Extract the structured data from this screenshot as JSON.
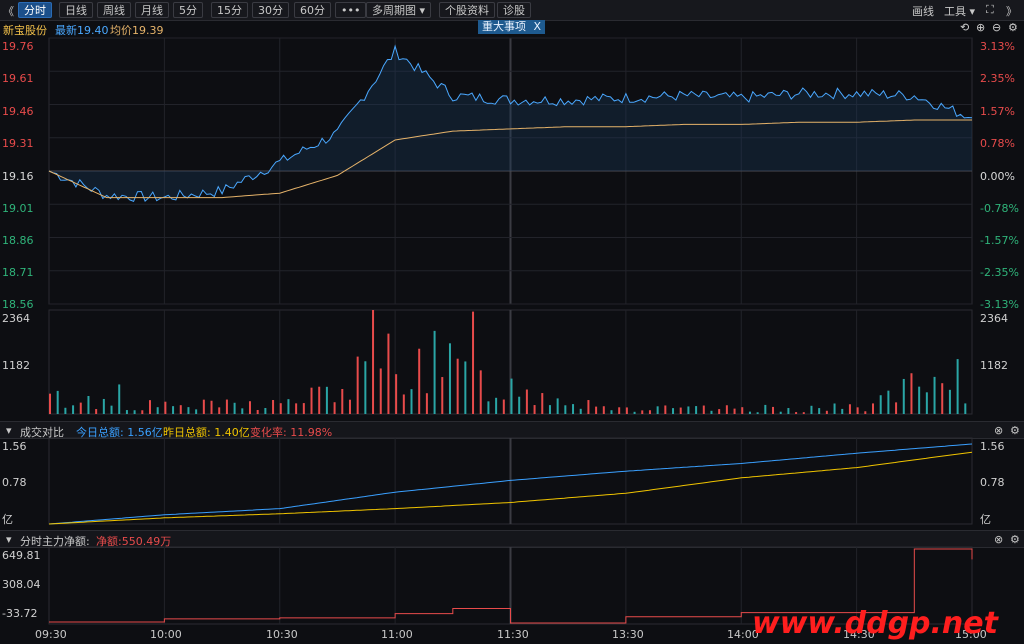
{
  "toolbar": {
    "back_glyph": "《",
    "tabs": [
      {
        "label": "分时",
        "active": true
      },
      {
        "label": "日线"
      },
      {
        "label": "周线"
      },
      {
        "label": "月线"
      },
      {
        "label": "5分"
      },
      {
        "label": "15分"
      },
      {
        "label": "30分"
      },
      {
        "label": "60分"
      },
      {
        "label": "•••"
      },
      {
        "label": "多周期图 ▾"
      },
      {
        "label": "个股资料"
      },
      {
        "label": "诊股"
      }
    ],
    "draw_label": "画线",
    "tools_label": "工具 ▾",
    "expand_glyph": "⛶",
    "forward_glyph": "》"
  },
  "info": {
    "stock_name": "新宝股份",
    "latest": "最新19.40",
    "avg": "均价19.39",
    "event_badge": "重大事项",
    "event_close": "X"
  },
  "price_panel": {
    "left_ticks": [
      "19.76",
      "19.61",
      "19.46",
      "19.31",
      "19.16",
      "19.01",
      "18.86",
      "18.71",
      "18.56"
    ],
    "right_ticks": [
      "3.13%",
      "2.35%",
      "1.57%",
      "0.78%",
      "0.00%",
      "-0.78%",
      "-1.57%",
      "-2.35%",
      "-3.13%"
    ]
  },
  "volume_panel": {
    "left_ticks": [
      "2364",
      "1182"
    ],
    "right_ticks": [
      "2364",
      "1182"
    ]
  },
  "turnover_panel": {
    "title": "成交对比",
    "today": "今日总额: 1.56亿",
    "yesterday": "昨日总额: 1.40亿",
    "change": "变化率: 11.98%",
    "left_ticks": [
      "1.56",
      "0.78",
      "亿"
    ],
    "right_ticks": [
      "1.56",
      "0.78",
      "亿"
    ]
  },
  "flow_panel": {
    "title": "分时主力净额:",
    "net": "净额:550.49万",
    "left_ticks": [
      "649.81",
      "308.04",
      "-33.72"
    ]
  },
  "time_axis": [
    "09:30",
    "10:00",
    "10:30",
    "11:00",
    "11:30",
    "13:30",
    "14:00",
    "14:30",
    "15:00"
  ],
  "watermark": "www.ddgp.net",
  "colors": {
    "up": "#e84b4b",
    "down": "#2fb47a",
    "price_line": "#4aa8ff",
    "avg_line": "#e6b36a",
    "today_line": "#3aa0ff",
    "yesterday_line": "#f0c400",
    "flow_line": "#e84b4b",
    "volume_up": "#e84b4b",
    "volume_down": "#2aa6a6",
    "watermark": "#ff1e1e"
  },
  "chart_data": [
    {
      "type": "line",
      "x": [
        "09:30",
        "09:45",
        "10:00",
        "10:15",
        "10:30",
        "10:45",
        "11:00",
        "11:15",
        "11:30",
        "13:15",
        "13:30",
        "13:45",
        "14:00",
        "14:15",
        "14:30",
        "14:45",
        "15:00"
      ],
      "series": [
        {
          "values": [
            19.16,
            19.05,
            19.04,
            19.07,
            19.2,
            19.33,
            19.7,
            19.5,
            19.48,
            19.48,
            19.49,
            19.5,
            19.49,
            19.51,
            19.51,
            19.5,
            19.4
          ]
        },
        {
          "values": [
            19.16,
            19.04,
            19.04,
            19.04,
            19.06,
            19.14,
            19.3,
            19.34,
            19.35,
            19.36,
            19.36,
            19.37,
            19.37,
            19.38,
            19.38,
            19.39,
            19.39
          ]
        }
      ],
      "ylim": [
        18.56,
        19.76
      ]
    },
    {
      "type": "bar",
      "x": [
        "09:30",
        "10:00",
        "10:30",
        "10:45",
        "11:00",
        "11:30",
        "13:30",
        "14:00",
        "14:30",
        "14:45",
        "15:00"
      ],
      "values": [
        600,
        300,
        400,
        900,
        2364,
        1000,
        200,
        200,
        250,
        1000,
        700
      ],
      "ylim": [
        0,
        2364
      ]
    },
    {
      "type": "line",
      "x": [
        "09:30",
        "10:00",
        "10:30",
        "11:00",
        "11:30",
        "13:30",
        "14:00",
        "14:30",
        "15:00"
      ],
      "series": [
        {
          "values": [
            0.0,
            0.18,
            0.3,
            0.62,
            0.85,
            1.03,
            1.18,
            1.38,
            1.56
          ]
        },
        {
          "values": [
            0.0,
            0.12,
            0.2,
            0.3,
            0.42,
            0.6,
            0.9,
            1.1,
            1.4
          ]
        }
      ],
      "ylim": [
        0,
        1.56
      ]
    },
    {
      "type": "line",
      "x": [
        "09:30",
        "10:00",
        "10:30",
        "11:00",
        "11:15",
        "11:30",
        "13:30",
        "14:00",
        "14:30",
        "14:45",
        "15:00"
      ],
      "values": [
        -50,
        -20,
        -10,
        30,
        80,
        -60,
        0,
        40,
        40,
        649.81,
        550.49
      ],
      "ylim": [
        -50,
        649.81
      ]
    }
  ]
}
